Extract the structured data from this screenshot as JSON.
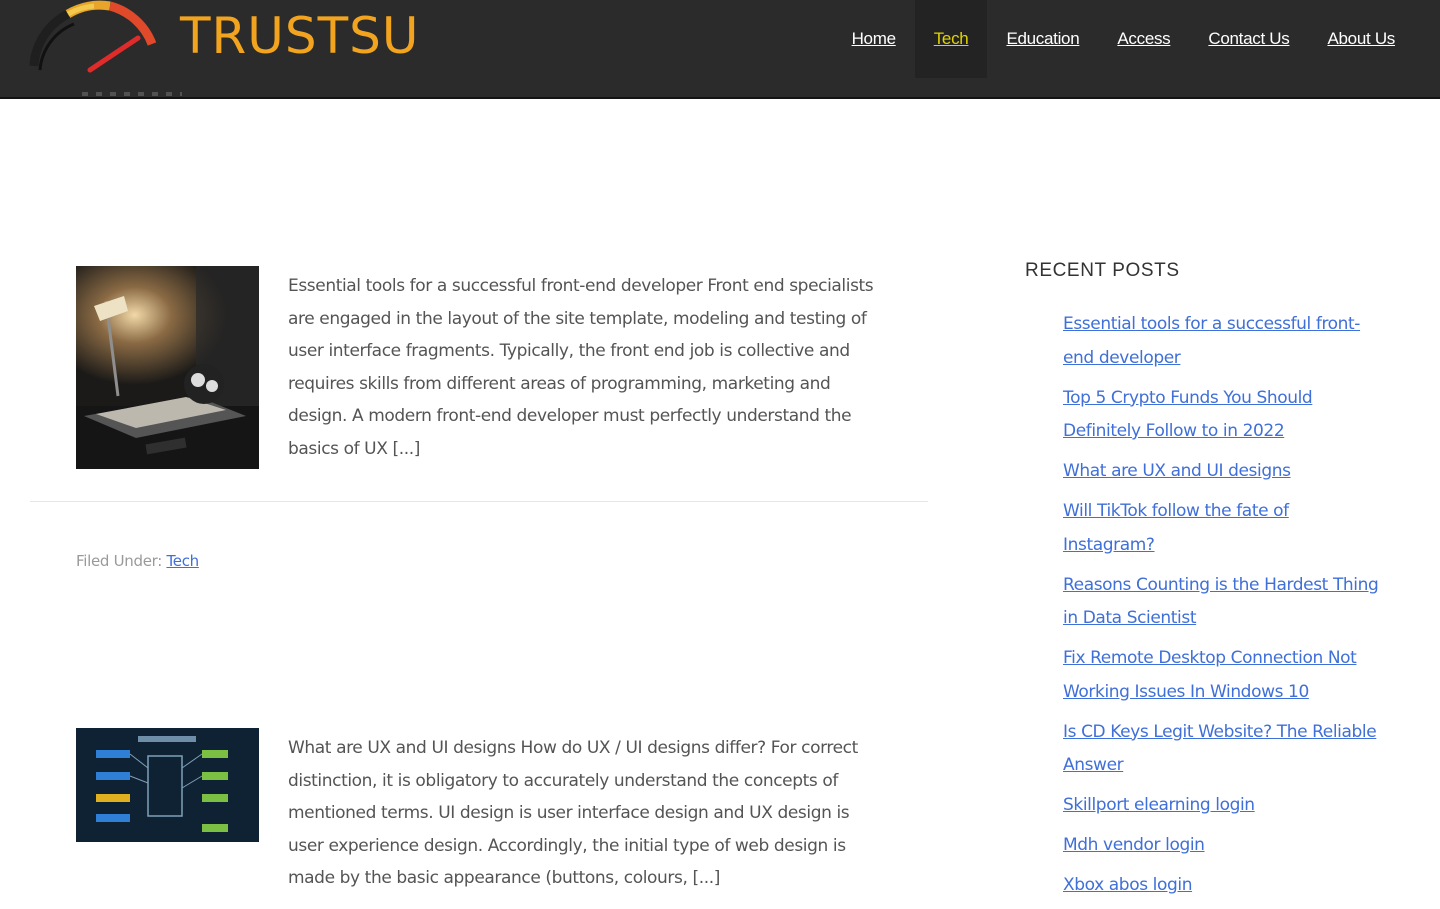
{
  "site": {
    "name": "TRUSTSU"
  },
  "nav": [
    {
      "label": "Home",
      "active": false
    },
    {
      "label": "Tech",
      "active": true
    },
    {
      "label": "Education",
      "active": false
    },
    {
      "label": "Access",
      "active": false
    },
    {
      "label": "Contact Us",
      "active": false
    },
    {
      "label": "About Us",
      "active": false
    }
  ],
  "posts": [
    {
      "excerpt": "Essential tools for a successful front-end developer Front end specialists are engaged in the layout of the site template, modeling and testing of user interface fragments. Typically, the front end job is collective and requires skills from different areas of programming, marketing and design. A modern front-end developer must perfectly understand the basics of UX [...]",
      "filed_label": "Filed Under:",
      "category": "Tech"
    },
    {
      "excerpt": "What are UX and UI designs How do UX / UI designs differ?   For correct distinction, it is obligatory to accurately understand the concepts of mentioned terms. UI design is user interface design and UX design is user experience design. Accordingly, the initial type of web design is made by the basic appearance (buttons, colours, [...]"
    }
  ],
  "sidebar": {
    "title": "RECENT POSTS",
    "items": [
      "Essential tools for a successful front-end developer",
      "Top 5 Crypto Funds You Should Definitely Follow to in 2022",
      "What are UX and UI designs",
      "Will TikTok follow the fate of Instagram?",
      "Reasons Counting is the Hardest Thing in Data Scientist",
      "Fix Remote Desktop Connection Not Working Issues In Windows 10",
      "Is CD Keys Legit Website? The Reliable Answer",
      "Skillport elearning login",
      "Mdh vendor login",
      "Xbox abos login"
    ]
  },
  "colors": {
    "header_bg": "#2b2b2b",
    "logo_orange": "#f3a41f",
    "nav_active": "#e2d200",
    "link_blue": "#3f6fd8"
  }
}
